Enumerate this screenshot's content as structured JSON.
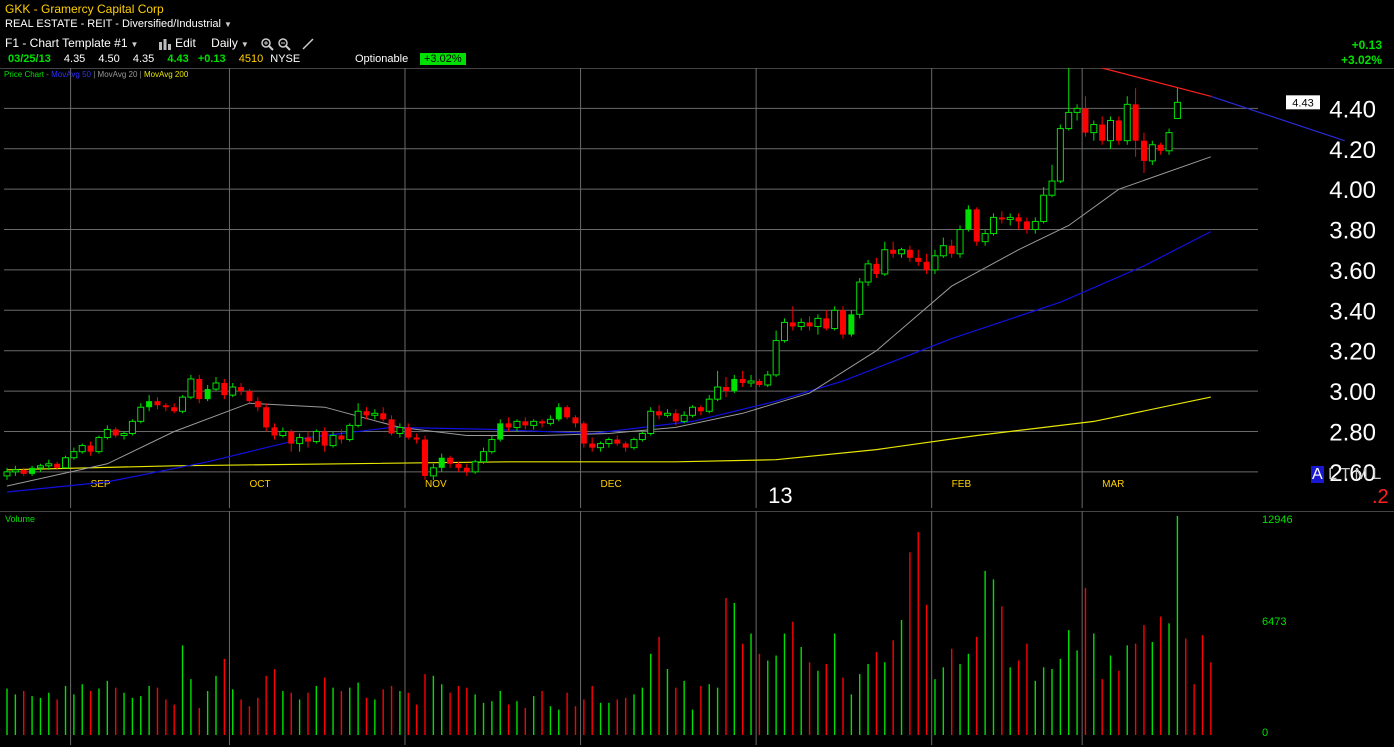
{
  "header": {
    "symbol_line": "GKK - Gramercy Capital Corp",
    "sector": "REAL ESTATE - REIT - Diversified/Industrial",
    "template": "F1 - Chart Template #1",
    "edit_label": "Edit",
    "period_label": "Daily",
    "optionable_label": "Optionable",
    "optionable_pct": "+3.02%"
  },
  "quote": {
    "date": "03/25/13",
    "open": "4.35",
    "high": "4.50",
    "low": "4.35",
    "close": "4.43",
    "change": "+0.13",
    "volume": "4510",
    "exchange": "NYSE"
  },
  "change_box": {
    "abs": "+0.13",
    "pct": "+3.02%"
  },
  "legend": {
    "price_chart": "Price Chart",
    "ma50": "MovAvg 50",
    "ma20": "MovAvg 20",
    "ma200": "MovAvg 200"
  },
  "price_badge": "4.43",
  "axis_controls": {
    "a": "A",
    "l": "L",
    "t": "T",
    "m": "M",
    "l2": "L"
  },
  "corner_value": ".2",
  "volume_panel": {
    "title": "Volume",
    "max": "12946",
    "mid": "6473",
    "zero": "0"
  },
  "colors": {
    "up": "#00e000",
    "down": "#ff0000",
    "ma20": "#9a9a9a",
    "ma50": "#1010e0",
    "ma200": "#e6e600",
    "grid": "#6a6a6a",
    "trend_red": "#ff2020",
    "trend_blue": "#2a2ad8"
  },
  "chart_data": {
    "type": "candlestick",
    "y_ticks": [
      "4.40",
      "4.20",
      "4.00",
      "3.80",
      "3.60",
      "3.40",
      "3.20",
      "3.00",
      "2.80",
      "2.60"
    ],
    "ylim": [
      2.52,
      4.6
    ],
    "x_labels": [
      "SEP",
      "OCT",
      "NOV",
      "DEC",
      "13",
      "FEB",
      "MAR"
    ],
    "x_label_index": [
      10,
      29,
      50,
      71,
      92,
      113,
      131
    ],
    "candles": [
      [
        2.58,
        2.62,
        2.56,
        2.6
      ],
      [
        2.6,
        2.63,
        2.58,
        2.61
      ],
      [
        2.61,
        2.62,
        2.58,
        2.59
      ],
      [
        2.59,
        2.63,
        2.58,
        2.62
      ],
      [
        2.62,
        2.64,
        2.6,
        2.63
      ],
      [
        2.63,
        2.66,
        2.61,
        2.64
      ],
      [
        2.64,
        2.65,
        2.61,
        2.62
      ],
      [
        2.62,
        2.68,
        2.62,
        2.67
      ],
      [
        2.67,
        2.72,
        2.66,
        2.7
      ],
      [
        2.7,
        2.74,
        2.69,
        2.73
      ],
      [
        2.73,
        2.75,
        2.68,
        2.7
      ],
      [
        2.7,
        2.78,
        2.69,
        2.77
      ],
      [
        2.77,
        2.83,
        2.76,
        2.81
      ],
      [
        2.81,
        2.82,
        2.77,
        2.78
      ],
      [
        2.78,
        2.8,
        2.76,
        2.79
      ],
      [
        2.79,
        2.86,
        2.78,
        2.85
      ],
      [
        2.85,
        2.94,
        2.84,
        2.92
      ],
      [
        2.92,
        2.98,
        2.9,
        2.95
      ],
      [
        2.95,
        2.97,
        2.91,
        2.93
      ],
      [
        2.93,
        2.94,
        2.9,
        2.92
      ],
      [
        2.92,
        2.94,
        2.89,
        2.9
      ],
      [
        2.9,
        2.98,
        2.89,
        2.97
      ],
      [
        2.97,
        3.08,
        2.96,
        3.06
      ],
      [
        3.06,
        3.08,
        2.94,
        2.96
      ],
      [
        2.96,
        3.03,
        2.95,
        3.01
      ],
      [
        3.01,
        3.07,
        3.0,
        3.04
      ],
      [
        3.04,
        3.06,
        2.96,
        2.98
      ],
      [
        2.98,
        3.04,
        2.97,
        3.02
      ],
      [
        3.02,
        3.04,
        2.98,
        3.0
      ],
      [
        3.0,
        3.01,
        2.94,
        2.95
      ],
      [
        2.95,
        2.97,
        2.9,
        2.92
      ],
      [
        2.92,
        2.94,
        2.8,
        2.82
      ],
      [
        2.82,
        2.84,
        2.76,
        2.78
      ],
      [
        2.78,
        2.82,
        2.77,
        2.8
      ],
      [
        2.8,
        2.81,
        2.7,
        2.74
      ],
      [
        2.74,
        2.79,
        2.7,
        2.77
      ],
      [
        2.77,
        2.8,
        2.72,
        2.75
      ],
      [
        2.75,
        2.81,
        2.74,
        2.8
      ],
      [
        2.8,
        2.82,
        2.7,
        2.73
      ],
      [
        2.73,
        2.8,
        2.72,
        2.78
      ],
      [
        2.78,
        2.81,
        2.74,
        2.76
      ],
      [
        2.76,
        2.84,
        2.75,
        2.83
      ],
      [
        2.83,
        2.94,
        2.82,
        2.9
      ],
      [
        2.9,
        2.92,
        2.86,
        2.88
      ],
      [
        2.88,
        2.91,
        2.86,
        2.89
      ],
      [
        2.89,
        2.92,
        2.85,
        2.86
      ],
      [
        2.86,
        2.88,
        2.78,
        2.79
      ],
      [
        2.79,
        2.84,
        2.77,
        2.82
      ],
      [
        2.82,
        2.84,
        2.76,
        2.77
      ],
      [
        2.77,
        2.79,
        2.74,
        2.76
      ],
      [
        2.76,
        2.78,
        2.56,
        2.58
      ],
      [
        2.58,
        2.64,
        2.56,
        2.62
      ],
      [
        2.62,
        2.69,
        2.6,
        2.67
      ],
      [
        2.67,
        2.68,
        2.62,
        2.64
      ],
      [
        2.64,
        2.65,
        2.6,
        2.62
      ],
      [
        2.62,
        2.64,
        2.58,
        2.6
      ],
      [
        2.6,
        2.66,
        2.59,
        2.65
      ],
      [
        2.65,
        2.72,
        2.64,
        2.7
      ],
      [
        2.7,
        2.78,
        2.69,
        2.76
      ],
      [
        2.76,
        2.86,
        2.75,
        2.84
      ],
      [
        2.84,
        2.87,
        2.8,
        2.82
      ],
      [
        2.82,
        2.86,
        2.8,
        2.85
      ],
      [
        2.85,
        2.87,
        2.81,
        2.83
      ],
      [
        2.83,
        2.86,
        2.81,
        2.85
      ],
      [
        2.85,
        2.86,
        2.82,
        2.84
      ],
      [
        2.84,
        2.88,
        2.83,
        2.86
      ],
      [
        2.86,
        2.94,
        2.85,
        2.92
      ],
      [
        2.92,
        2.93,
        2.86,
        2.87
      ],
      [
        2.87,
        2.88,
        2.82,
        2.84
      ],
      [
        2.84,
        2.85,
        2.72,
        2.74
      ],
      [
        2.74,
        2.77,
        2.7,
        2.72
      ],
      [
        2.72,
        2.75,
        2.7,
        2.74
      ],
      [
        2.74,
        2.77,
        2.72,
        2.76
      ],
      [
        2.76,
        2.78,
        2.73,
        2.74
      ],
      [
        2.74,
        2.75,
        2.7,
        2.72
      ],
      [
        2.72,
        2.77,
        2.71,
        2.76
      ],
      [
        2.76,
        2.8,
        2.75,
        2.79
      ],
      [
        2.79,
        2.92,
        2.78,
        2.9
      ],
      [
        2.9,
        2.93,
        2.86,
        2.88
      ],
      [
        2.88,
        2.91,
        2.87,
        2.89
      ],
      [
        2.89,
        2.91,
        2.83,
        2.85
      ],
      [
        2.85,
        2.9,
        2.84,
        2.88
      ],
      [
        2.88,
        2.93,
        2.87,
        2.92
      ],
      [
        2.92,
        2.93,
        2.88,
        2.9
      ],
      [
        2.9,
        2.98,
        2.89,
        2.96
      ],
      [
        2.96,
        3.1,
        2.95,
        3.02
      ],
      [
        3.02,
        3.07,
        2.97,
        3.0
      ],
      [
        3.0,
        3.08,
        2.99,
        3.06
      ],
      [
        3.06,
        3.1,
        3.02,
        3.04
      ],
      [
        3.04,
        3.08,
        3.02,
        3.05
      ],
      [
        3.05,
        3.06,
        3.02,
        3.03
      ],
      [
        3.03,
        3.1,
        3.02,
        3.08
      ],
      [
        3.08,
        3.3,
        3.07,
        3.25
      ],
      [
        3.25,
        3.36,
        3.24,
        3.34
      ],
      [
        3.34,
        3.42,
        3.3,
        3.32
      ],
      [
        3.32,
        3.36,
        3.3,
        3.34
      ],
      [
        3.34,
        3.37,
        3.3,
        3.32
      ],
      [
        3.32,
        3.38,
        3.28,
        3.36
      ],
      [
        3.36,
        3.4,
        3.3,
        3.31
      ],
      [
        3.31,
        3.42,
        3.3,
        3.4
      ],
      [
        3.4,
        3.42,
        3.26,
        3.28
      ],
      [
        3.28,
        3.4,
        3.27,
        3.38
      ],
      [
        3.38,
        3.56,
        3.36,
        3.54
      ],
      [
        3.54,
        3.65,
        3.52,
        3.63
      ],
      [
        3.63,
        3.66,
        3.56,
        3.58
      ],
      [
        3.58,
        3.74,
        3.57,
        3.7
      ],
      [
        3.7,
        3.74,
        3.66,
        3.68
      ],
      [
        3.68,
        3.71,
        3.66,
        3.7
      ],
      [
        3.7,
        3.72,
        3.64,
        3.66
      ],
      [
        3.66,
        3.7,
        3.62,
        3.64
      ],
      [
        3.64,
        3.68,
        3.58,
        3.6
      ],
      [
        3.6,
        3.7,
        3.58,
        3.67
      ],
      [
        3.67,
        3.76,
        3.66,
        3.72
      ],
      [
        3.72,
        3.75,
        3.66,
        3.68
      ],
      [
        3.68,
        3.82,
        3.66,
        3.8
      ],
      [
        3.8,
        3.92,
        3.79,
        3.9
      ],
      [
        3.9,
        3.91,
        3.72,
        3.74
      ],
      [
        3.74,
        3.8,
        3.72,
        3.78
      ],
      [
        3.78,
        3.88,
        3.77,
        3.86
      ],
      [
        3.86,
        3.89,
        3.83,
        3.85
      ],
      [
        3.85,
        3.88,
        3.82,
        3.86
      ],
      [
        3.86,
        3.88,
        3.8,
        3.84
      ],
      [
        3.84,
        3.86,
        3.78,
        3.8
      ],
      [
        3.8,
        3.86,
        3.78,
        3.84
      ],
      [
        3.84,
        4.01,
        3.83,
        3.97
      ],
      [
        3.97,
        4.12,
        3.96,
        4.04
      ],
      [
        4.04,
        4.32,
        4.03,
        4.3
      ],
      [
        4.3,
        4.6,
        4.29,
        4.38
      ],
      [
        4.38,
        4.42,
        4.34,
        4.4
      ],
      [
        4.4,
        4.46,
        4.26,
        4.28
      ],
      [
        4.28,
        4.34,
        4.24,
        4.32
      ],
      [
        4.32,
        4.36,
        4.22,
        4.24
      ],
      [
        4.24,
        4.36,
        4.2,
        4.34
      ],
      [
        4.34,
        4.36,
        4.22,
        4.24
      ],
      [
        4.24,
        4.46,
        4.22,
        4.42
      ],
      [
        4.42,
        4.5,
        4.16,
        4.24
      ],
      [
        4.24,
        4.28,
        4.08,
        4.14
      ],
      [
        4.14,
        4.24,
        4.12,
        4.22
      ],
      [
        4.22,
        4.23,
        4.17,
        4.19
      ],
      [
        4.19,
        4.3,
        4.17,
        4.28
      ],
      [
        4.35,
        4.5,
        4.35,
        4.43
      ]
    ],
    "moving_averages": {
      "ma20": [
        [
          0,
          2.53
        ],
        [
          12,
          2.64
        ],
        [
          20,
          2.8
        ],
        [
          29,
          2.94
        ],
        [
          38,
          2.92
        ],
        [
          47,
          2.82
        ],
        [
          55,
          2.78
        ],
        [
          64,
          2.78
        ],
        [
          72,
          2.79
        ],
        [
          80,
          2.82
        ],
        [
          88,
          2.89
        ],
        [
          96,
          2.99
        ],
        [
          104,
          3.2
        ],
        [
          113,
          3.52
        ],
        [
          121,
          3.7
        ],
        [
          127,
          3.82
        ],
        [
          133,
          4.0
        ],
        [
          144,
          4.16
        ]
      ],
      "ma50": [
        [
          0,
          2.5
        ],
        [
          12,
          2.55
        ],
        [
          24,
          2.65
        ],
        [
          36,
          2.77
        ],
        [
          46,
          2.82
        ],
        [
          58,
          2.81
        ],
        [
          70,
          2.79
        ],
        [
          82,
          2.85
        ],
        [
          92,
          2.95
        ],
        [
          100,
          3.05
        ],
        [
          113,
          3.26
        ],
        [
          126,
          3.44
        ],
        [
          136,
          3.62
        ],
        [
          144,
          3.79
        ]
      ],
      "ma200": [
        [
          0,
          2.61
        ],
        [
          20,
          2.63
        ],
        [
          40,
          2.64
        ],
        [
          60,
          2.65
        ],
        [
          80,
          2.65
        ],
        [
          92,
          2.66
        ],
        [
          104,
          2.71
        ],
        [
          116,
          2.78
        ],
        [
          130,
          2.85
        ],
        [
          144,
          2.97
        ]
      ]
    },
    "trendlines": [
      {
        "color": "red",
        "points": [
          [
            131,
            4.6
          ],
          [
            144,
            4.46
          ]
        ]
      },
      {
        "color": "blue",
        "points": [
          [
            144,
            4.46
          ],
          [
            160,
            4.24
          ]
        ]
      }
    ],
    "volume": [
      2750,
      2400,
      2600,
      2300,
      2200,
      2500,
      2100,
      2900,
      2400,
      3000,
      2600,
      2750,
      3200,
      2800,
      2500,
      2200,
      2300,
      2900,
      2800,
      2100,
      1800,
      5300,
      3300,
      1600,
      2600,
      3500,
      4500,
      2700,
      2100,
      1700,
      2200,
      3500,
      3900,
      2600,
      2500,
      2100,
      2500,
      2900,
      3400,
      2800,
      2600,
      2800,
      3100,
      2200,
      2100,
      2700,
      2900,
      2600,
      2500,
      1800,
      3600,
      3500,
      3000,
      2500,
      2900,
      2800,
      2400,
      1900,
      2000,
      2600,
      1800,
      2000,
      1600,
      2300,
      2600,
      1700,
      1500,
      2500,
      1700,
      2100,
      2900,
      1900,
      1900,
      2100,
      2200,
      2400,
      2800,
      4800,
      5800,
      3900,
      2800,
      3200,
      1500,
      2900,
      3000,
      2800,
      8100,
      7800,
      5400,
      6000,
      4800,
      4400,
      4700,
      6000,
      6700,
      5200,
      4300,
      3800,
      4200,
      6000,
      3400,
      2400,
      3600,
      4200,
      4900,
      4300,
      5600,
      6800,
      10800,
      12000,
      7700,
      3300,
      4000,
      5100,
      4200,
      4800,
      5800,
      9700,
      9200,
      7600,
      4000,
      4400,
      5400,
      3200,
      4000,
      3900,
      4500,
      6200,
      5000,
      8700,
      6000,
      3300,
      4700,
      3800,
      5300,
      5400,
      6500,
      5500,
      7000,
      6600,
      12946,
      5700,
      3000,
      5900,
      4300
    ],
    "volume_ylim": [
      0,
      12946
    ]
  }
}
